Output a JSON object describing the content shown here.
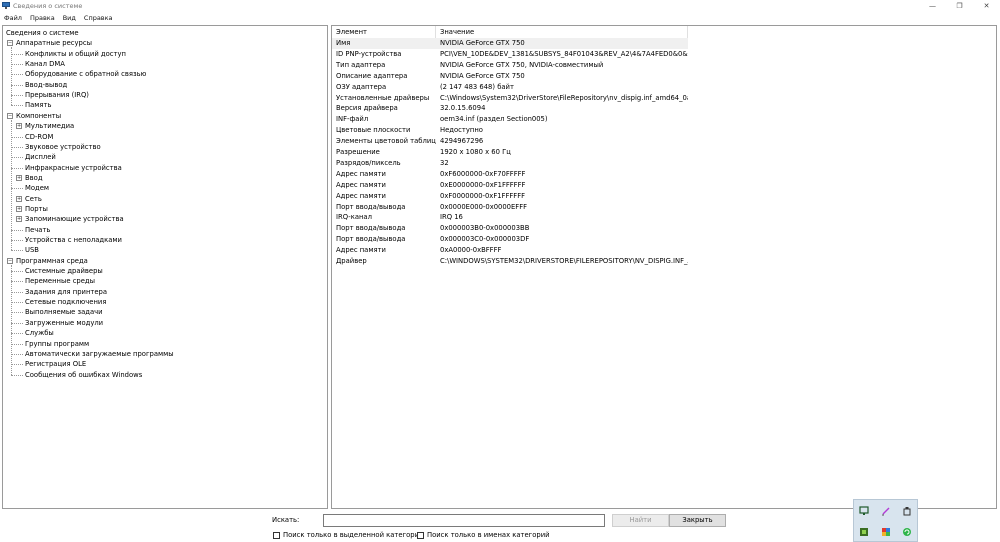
{
  "window": {
    "title": "Сведения о системе"
  },
  "menu": [
    "Файл",
    "Правка",
    "Вид",
    "Справка"
  ],
  "tree": [
    {
      "label": "Сведения о системе",
      "level": 0,
      "expander": ""
    },
    {
      "label": "Аппаратные ресурсы",
      "level": 1,
      "expander": "−"
    },
    {
      "label": "Конфликты и общий доступ",
      "level": 2,
      "expander": ""
    },
    {
      "label": "Канал DMA",
      "level": 2,
      "expander": ""
    },
    {
      "label": "Оборудование с обратной связью",
      "level": 2,
      "expander": ""
    },
    {
      "label": "Ввод-вывод",
      "level": 2,
      "expander": ""
    },
    {
      "label": "Прерывания (IRQ)",
      "level": 2,
      "expander": ""
    },
    {
      "label": "Память",
      "level": 2,
      "expander": ""
    },
    {
      "label": "Компоненты",
      "level": 1,
      "expander": "−"
    },
    {
      "label": "Мультимедиа",
      "level": 2,
      "expander": "+"
    },
    {
      "label": "CD-ROM",
      "level": 2,
      "expander": ""
    },
    {
      "label": "Звуковое устройство",
      "level": 2,
      "expander": ""
    },
    {
      "label": "Дисплей",
      "level": 2,
      "expander": ""
    },
    {
      "label": "Инфракрасные устройства",
      "level": 2,
      "expander": ""
    },
    {
      "label": "Ввод",
      "level": 2,
      "expander": "+"
    },
    {
      "label": "Модем",
      "level": 2,
      "expander": ""
    },
    {
      "label": "Сеть",
      "level": 2,
      "expander": "+"
    },
    {
      "label": "Порты",
      "level": 2,
      "expander": "+"
    },
    {
      "label": "Запоминающие устройства",
      "level": 2,
      "expander": "+"
    },
    {
      "label": "Печать",
      "level": 2,
      "expander": ""
    },
    {
      "label": "Устройства с неполадками",
      "level": 2,
      "expander": ""
    },
    {
      "label": "USB",
      "level": 2,
      "expander": ""
    },
    {
      "label": "Программная среда",
      "level": 1,
      "expander": "−"
    },
    {
      "label": "Системные драйверы",
      "level": 2,
      "expander": ""
    },
    {
      "label": "Переменные среды",
      "level": 2,
      "expander": ""
    },
    {
      "label": "Задания для принтера",
      "level": 2,
      "expander": ""
    },
    {
      "label": "Сетевые подключения",
      "level": 2,
      "expander": ""
    },
    {
      "label": "Выполняемые задачи",
      "level": 2,
      "expander": ""
    },
    {
      "label": "Загруженные модули",
      "level": 2,
      "expander": ""
    },
    {
      "label": "Службы",
      "level": 2,
      "expander": ""
    },
    {
      "label": "Группы программ",
      "level": 2,
      "expander": ""
    },
    {
      "label": "Автоматически загружаемые программы",
      "level": 2,
      "expander": ""
    },
    {
      "label": "Регистрация OLE",
      "level": 2,
      "expander": ""
    },
    {
      "label": "Сообщения об ошибках Windows",
      "level": 2,
      "expander": ""
    }
  ],
  "list": {
    "col_element": "Элемент",
    "col_value": "Значение",
    "rows": [
      {
        "k": "Имя",
        "v": "NVIDIA GeForce GTX 750"
      },
      {
        "k": "ID PNP-устройства",
        "v": "PCI\\VEN_10DE&DEV_1381&SUBSYS_84F01043&REV_A2\\4&7A4FED0&0&0008"
      },
      {
        "k": "Тип адаптера",
        "v": "NVIDIA GeForce GTX 750, NVIDIA-совместимый"
      },
      {
        "k": "Описание адаптера",
        "v": "NVIDIA GeForce GTX 750"
      },
      {
        "k": "ОЗУ адаптера",
        "v": "(2 147 483 648) байт"
      },
      {
        "k": "Установленные драйверы",
        "v": "C:\\Windows\\System32\\DriverStore\\FileRepository\\nv_dispig.inf_amd64_0afec3..."
      },
      {
        "k": "Версия драйвера",
        "v": "32.0.15.6094"
      },
      {
        "k": "INF-файл",
        "v": "oem34.inf (раздел Section005)"
      },
      {
        "k": "Цветовые плоскости",
        "v": "Недоступно"
      },
      {
        "k": "Элементы цветовой таблицы",
        "v": "4294967296"
      },
      {
        "k": "Разрешение",
        "v": "1920 x 1080 x 60 Гц"
      },
      {
        "k": "Разрядов/пиксель",
        "v": "32"
      },
      {
        "k": "Адрес памяти",
        "v": "0xF6000000-0xF70FFFFF"
      },
      {
        "k": "Адрес памяти",
        "v": "0xE0000000-0xF1FFFFFF"
      },
      {
        "k": "Адрес памяти",
        "v": "0xF0000000-0xF1FFFFFF"
      },
      {
        "k": "Порт ввода/вывода",
        "v": "0x0000E000-0x0000EFFF"
      },
      {
        "k": "IRQ-канал",
        "v": "IRQ 16"
      },
      {
        "k": "Порт ввода/вывода",
        "v": "0x000003B0-0x000003BB"
      },
      {
        "k": "Порт ввода/вывода",
        "v": "0x000003C0-0x000003DF"
      },
      {
        "k": "Адрес памяти",
        "v": "0xA0000-0xBFFFF"
      },
      {
        "k": "Драйвер",
        "v": "C:\\WINDOWS\\SYSTEM32\\DRIVERSTORE\\FILEREPOSITORY\\NV_DISPIG.INF_AMD..."
      }
    ]
  },
  "search": {
    "label": "Искать:",
    "value": "",
    "find_button": "Найти",
    "close_button": "Закрыть",
    "chk_selected_category": "Поиск только в выделенной категории",
    "chk_category_names": "Поиск только в именах категорий"
  },
  "tray_icons": [
    "monitor-icon",
    "pen-icon",
    "usb-drive-icon",
    "gpu-icon",
    "app-icon",
    "update-icon"
  ]
}
